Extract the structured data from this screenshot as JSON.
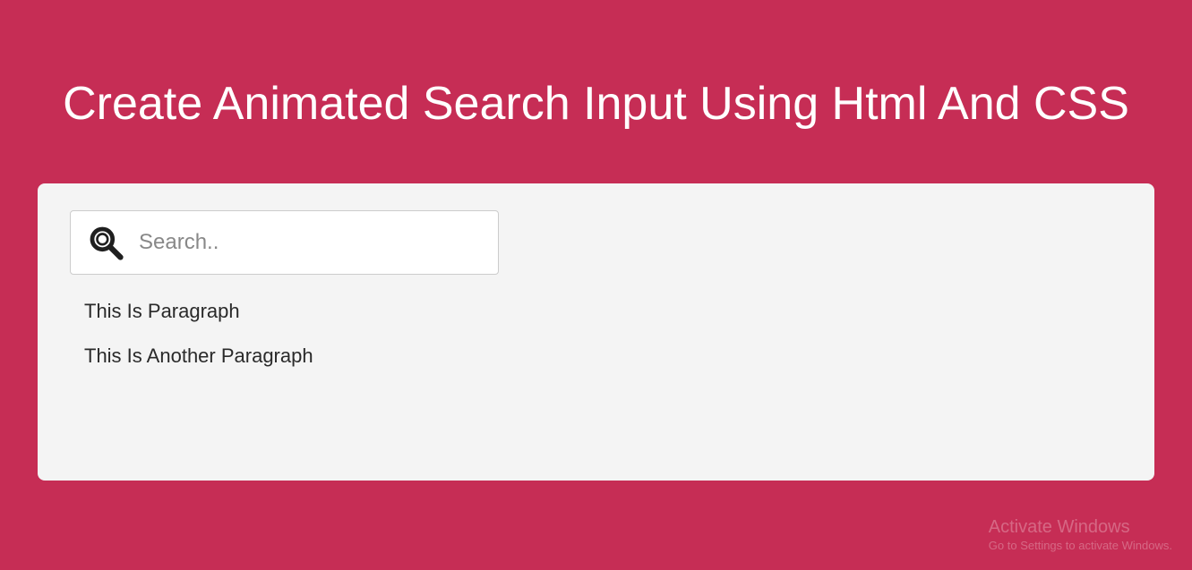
{
  "header": {
    "title": "Create Animated Search Input Using Html And CSS"
  },
  "card": {
    "search": {
      "placeholder": "Search..",
      "value": ""
    },
    "paragraphs": [
      "This Is Paragraph",
      "This Is Another Paragraph"
    ]
  },
  "watermark": {
    "title": "Activate Windows",
    "sub": "Go to Settings to activate Windows."
  }
}
